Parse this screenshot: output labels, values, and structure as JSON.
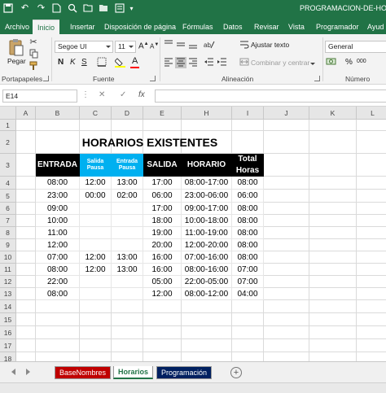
{
  "window": {
    "title": "PROGRAMACION-DE-HORA",
    "accent_color": "#217346"
  },
  "ribbon_tabs": [
    "Archivo",
    "Inicio",
    "Insertar",
    "Disposición de página",
    "Fórmulas",
    "Datos",
    "Revisar",
    "Vista",
    "Programador",
    "Ayud"
  ],
  "ribbon": {
    "paste_label": "Pegar",
    "font_name": "Segoe UI",
    "font_size": "11",
    "wrap_text_label": "Ajustar texto",
    "merge_center_label": "Combinar y centrar",
    "number_format": "General",
    "group_clipboard": "Portapapeles",
    "group_font": "Fuente",
    "group_alignment": "Alineación",
    "group_number": "Número",
    "bold_label": "N",
    "italic_label": "K",
    "underline_label": "S",
    "font_color_letter": "A",
    "percent_label": "%"
  },
  "formula_bar": {
    "name_box": "E14",
    "cancel_symbol": "✕",
    "enter_symbol": "✓",
    "fx_symbol": "fx",
    "formula": ""
  },
  "columns": [
    "A",
    "B",
    "C",
    "D",
    "E",
    "H",
    "I",
    "J",
    "K",
    "L"
  ],
  "rows": [
    "1",
    "2",
    "3",
    "4",
    "5",
    "6",
    "7",
    "8",
    "9",
    "10",
    "11",
    "12",
    "13",
    "14",
    "15",
    "16",
    "17",
    "18"
  ],
  "sheet": {
    "title": "HORARIOS EXISTENTES",
    "headers": {
      "entrada": "ENTRADA",
      "salida_pausa": "Salida Pausa",
      "entrada_pausa": "Entrada Pausa",
      "salida": "SALIDA",
      "horario": "HORARIO",
      "total_horas": "Total Horas"
    },
    "data_rows": [
      {
        "entrada": "08:00",
        "salida_pausa": "12:00",
        "entrada_pausa": "13:00",
        "salida": "17:00",
        "horario": "08:00-17:00",
        "total_horas": "08:00"
      },
      {
        "entrada": "23:00",
        "salida_pausa": "00:00",
        "entrada_pausa": "02:00",
        "salida": "06:00",
        "horario": "23:00-06:00",
        "total_horas": "06:00"
      },
      {
        "entrada": "09:00",
        "salida_pausa": "",
        "entrada_pausa": "",
        "salida": "17:00",
        "horario": "09:00-17:00",
        "total_horas": "08:00"
      },
      {
        "entrada": "10:00",
        "salida_pausa": "",
        "entrada_pausa": "",
        "salida": "18:00",
        "horario": "10:00-18:00",
        "total_horas": "08:00"
      },
      {
        "entrada": "11:00",
        "salida_pausa": "",
        "entrada_pausa": "",
        "salida": "19:00",
        "horario": "11:00-19:00",
        "total_horas": "08:00"
      },
      {
        "entrada": "12:00",
        "salida_pausa": "",
        "entrada_pausa": "",
        "salida": "20:00",
        "horario": "12:00-20:00",
        "total_horas": "08:00"
      },
      {
        "entrada": "07:00",
        "salida_pausa": "12:00",
        "entrada_pausa": "13:00",
        "salida": "16:00",
        "horario": "07:00-16:00",
        "total_horas": "08:00"
      },
      {
        "entrada": "08:00",
        "salida_pausa": "12:00",
        "entrada_pausa": "13:00",
        "salida": "16:00",
        "horario": "08:00-16:00",
        "total_horas": "07:00"
      },
      {
        "entrada": "22:00",
        "salida_pausa": "",
        "entrada_pausa": "",
        "salida": "05:00",
        "horario": "22:00-05:00",
        "total_horas": "07:00"
      },
      {
        "entrada": "08:00",
        "salida_pausa": "",
        "entrada_pausa": "",
        "salida": "12:00",
        "horario": "08:00-12:00",
        "total_horas": "04:00"
      }
    ],
    "header_black_color": "#000000",
    "header_blue_color": "#00b0f0"
  },
  "sheet_tabs": [
    {
      "label": "BaseNombres",
      "color": "#c00000"
    },
    {
      "label": "Horarios",
      "color": "#217346"
    },
    {
      "label": "Programación",
      "color": "#002060"
    }
  ]
}
